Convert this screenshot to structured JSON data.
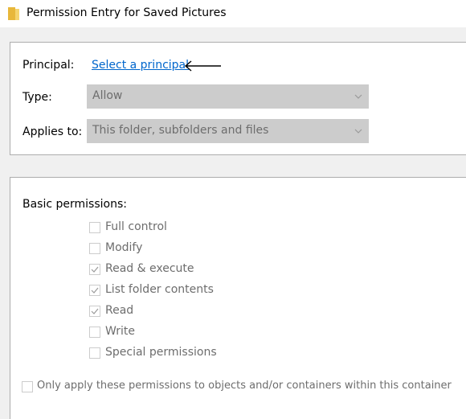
{
  "window": {
    "title": "Permission Entry for Saved Pictures",
    "icon": "folder-icon"
  },
  "principal": {
    "label": "Principal:",
    "link_text": "Select a principal",
    "arrow_icon": "arrow-left-icon"
  },
  "type": {
    "label": "Type:",
    "value": "Allow"
  },
  "applies_to": {
    "label": "Applies to:",
    "value": "This folder, subfolders and files"
  },
  "permissions": {
    "heading": "Basic permissions:",
    "items": [
      {
        "label": "Full control",
        "checked": false
      },
      {
        "label": "Modify",
        "checked": false
      },
      {
        "label": "Read & execute",
        "checked": true
      },
      {
        "label": "List folder contents",
        "checked": true
      },
      {
        "label": "Read",
        "checked": true
      },
      {
        "label": "Write",
        "checked": false
      },
      {
        "label": "Special permissions",
        "checked": false
      }
    ]
  },
  "only_apply": {
    "label": "Only apply these permissions to objects and/or containers within this container",
    "checked": false
  },
  "colors": {
    "link": "#0066cc",
    "disabled_text": "#6d6d6d",
    "disabled_fill": "#cccccc",
    "folder": "#e8b73a"
  }
}
